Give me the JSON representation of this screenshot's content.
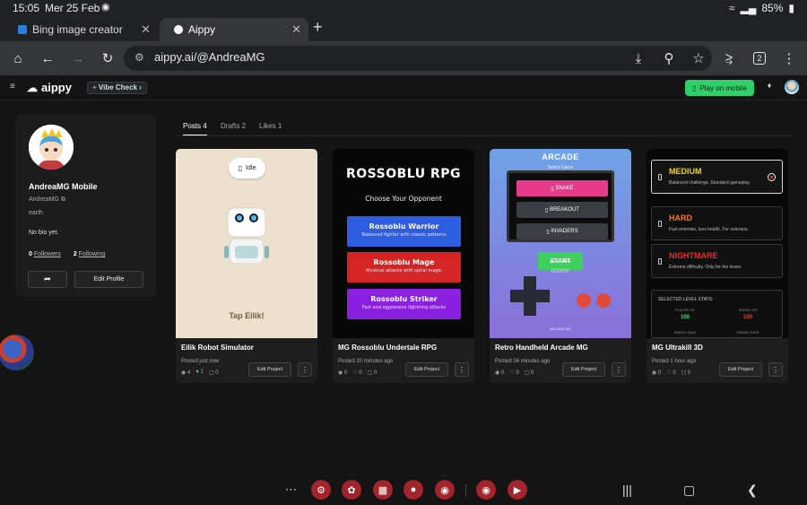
{
  "status_bar": {
    "time": "15:05",
    "date": "Mer 25 Feb",
    "battery": "85%"
  },
  "browser": {
    "tabs": [
      {
        "title": "Bing image creator",
        "favicon_color": "#2a7de1"
      },
      {
        "title": "Aippy",
        "favicon_color": "#ffffff"
      }
    ],
    "url": "aippy.ai/@AndreaMG",
    "tab_count": "2"
  },
  "app_header": {
    "brand": "aippy",
    "vibe_check": "Vibe Check",
    "play_on_mobile": "Play on mobile"
  },
  "profile": {
    "display_name": "AndreaMG Mobile",
    "handle": "AndreaMG",
    "location": "earth",
    "bio": "No bio yet.",
    "followers_count": "0",
    "followers_label": "Followers",
    "following_count": "2",
    "following_label": "Following",
    "edit_profile": "Edit Profile"
  },
  "content_tabs": [
    "Posts 4",
    "Drafts 2",
    "Likes 1"
  ],
  "cards": [
    {
      "title": "Eilik Robot Simulator",
      "posted": "Posted just now",
      "views": "4",
      "likes": "1",
      "comments": "0",
      "edit": "Edit Project",
      "preview": {
        "pill": "Idle",
        "caption": "Tap Eilik!"
      }
    },
    {
      "title": "MG Rossoblu Undertale RPG",
      "posted": "Posted 20 minutes ago",
      "views": "0",
      "likes": "0",
      "comments": "0",
      "edit": "Edit Project",
      "preview": {
        "title": "ROSSOBLU RPG",
        "subtitle": "Choose Your Opponent",
        "options": [
          {
            "name": "Rossoblu Warrior",
            "desc": "Balanced fighter with classic patterns",
            "color": "#2d5de0"
          },
          {
            "name": "Rossoblu Mage",
            "desc": "Mystical attacks with spiral magic",
            "color": "#d62424"
          },
          {
            "name": "Rossoblu Striker",
            "desc": "Fast and aggressive lightning attacks",
            "color": "#8a1fe0"
          }
        ]
      }
    },
    {
      "title": "Retro Handheld Arcade MG",
      "posted": "Posted 34 minutes ago",
      "views": "0",
      "likes": "0",
      "comments": "0",
      "edit": "Edit Project",
      "preview": {
        "title": "ARCADE",
        "select": "Select Game",
        "games": [
          "SNAKE",
          "BREAKOUT",
          "INVADERS"
        ],
        "start": "START",
        "score": "000000",
        "footer": "ARCADE MG"
      }
    },
    {
      "title": "MG Ultrakill 3D",
      "posted": "Posted 1 hour ago",
      "views": "0",
      "likes": "0",
      "comments": "0",
      "edit": "Edit Project",
      "preview": {
        "difficulties": [
          {
            "name": "MEDIUM",
            "desc": "Balanced challenge. Standard gameplay.",
            "color": "#f2d21b"
          },
          {
            "name": "HARD",
            "desc": "Fast enemies, less health. For veterans.",
            "color": "#f07a1a"
          },
          {
            "name": "NIGHTMARE",
            "desc": "Extreme difficulty. Only for the brave.",
            "color": "#ee2a2a"
          }
        ],
        "stats_header": "SELECTED LEVEL STATS:",
        "player_hp_label": "PLAYER HP",
        "player_hp": "100",
        "enemy_hp_label": "ENEMY HP",
        "enemy_hp": "100",
        "enemy_dmg_label": "ENEMY DMG",
        "spawn_rate_label": "SPAWN RATE"
      }
    }
  ],
  "dock_colors": [
    "#c4262a",
    "#c4262a",
    "#c4262a",
    "#c4262a",
    "#c4262a",
    "#c4262a",
    "#c4262a"
  ]
}
